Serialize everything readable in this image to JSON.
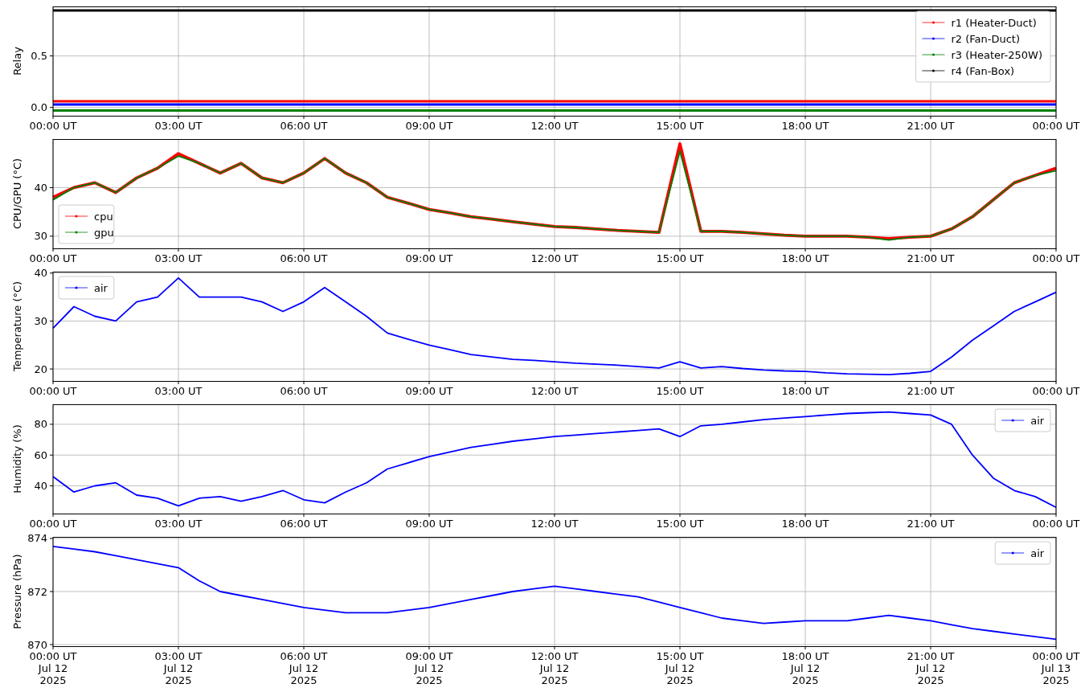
{
  "panels": [
    {
      "chart_data": {
        "type": "line",
        "grid": true,
        "legend": true,
        "ylabel": "Relay",
        "ylim": [
          -0.08,
          0.98
        ],
        "categories": [
          "00:00 UT",
          "03:00 UT",
          "06:00 UT",
          "09:00 UT",
          "12:00 UT",
          "15:00 UT",
          "18:00 UT",
          "21:00 UT",
          "00:00 UT"
        ],
        "yticks": [
          {
            "value": 0,
            "label": "0.0"
          },
          {
            "value": 0.5,
            "label": "0.5"
          }
        ],
        "series": [
          {
            "name": "r1 (Heater-Duct)",
            "color": "#ff0000",
            "values": [
              0.06,
              0.06,
              0.06,
              0.06,
              0.06,
              0.06,
              0.06,
              0.06,
              0.06
            ]
          },
          {
            "name": "r2 (Fan-Duct)",
            "color": "#0000ff",
            "values": [
              0.03,
              0.03,
              0.03,
              0.03,
              0.03,
              0.03,
              0.03,
              0.03,
              0.03
            ]
          },
          {
            "name": "r3 (Heater-250W)",
            "color": "#008000",
            "values": [
              -0.03,
              -0.03,
              -0.03,
              -0.03,
              -0.03,
              -0.03,
              -0.03,
              -0.03,
              -0.03
            ]
          },
          {
            "name": "r4 (Fan-Box)",
            "color": "#000000",
            "values": [
              0.94,
              0.94,
              0.94,
              0.94,
              0.94,
              0.94,
              0.94,
              0.94,
              0.94
            ]
          }
        ]
      }
    },
    {
      "chart_data": {
        "type": "line",
        "grid": true,
        "legend": true,
        "ylabel": "CPU/GPU (°C)",
        "ylim": [
          27.5,
          50
        ],
        "categories": [
          "00:00 UT",
          null,
          null,
          null,
          null,
          null,
          "03:00 UT",
          null,
          null,
          null,
          null,
          null,
          "06:00 UT",
          null,
          null,
          null,
          null,
          null,
          "09:00 UT",
          null,
          null,
          null,
          null,
          null,
          "12:00 UT",
          null,
          null,
          null,
          null,
          null,
          "15:00 UT",
          null,
          null,
          null,
          null,
          null,
          "18:00 UT",
          null,
          null,
          null,
          null,
          null,
          "21:00 UT",
          null,
          null,
          null,
          null,
          null,
          "00:00 UT"
        ],
        "yticks": [
          {
            "value": 30,
            "label": "30"
          },
          {
            "value": 40,
            "label": "40"
          }
        ],
        "series": [
          {
            "name": "cpu",
            "color": "#ff0000",
            "values": [
              38,
              40,
              41,
              39,
              42,
              44,
              47,
              45,
              43,
              45,
              42,
              41,
              43,
              46,
              43,
              41,
              38,
              36.8,
              35.5,
              34.8,
              34,
              33.5,
              33,
              32.5,
              32,
              31.8,
              31.5,
              31.2,
              31,
              30.8,
              49,
              31,
              31,
              30.8,
              30.5,
              30.2,
              30,
              30,
              30,
              29.8,
              29.5,
              29.8,
              30,
              31.5,
              34,
              37.5,
              41,
              42.5,
              44
            ]
          },
          {
            "name": "gpu",
            "color": "#008000",
            "values": [
              37.5,
              40,
              41,
              39,
              42,
              44,
              46.5,
              45,
              43,
              45,
              42,
              41,
              43,
              46,
              43,
              41,
              38,
              36.8,
              35.5,
              34.8,
              34,
              33.5,
              33,
              32.5,
              32,
              31.8,
              31.5,
              31.2,
              31,
              30.8,
              47.5,
              31,
              31,
              30.8,
              30.5,
              30.2,
              30,
              30,
              30,
              29.8,
              29.2,
              29.8,
              30,
              31.5,
              34,
              37.5,
              41,
              42.5,
              43.5
            ]
          }
        ]
      }
    },
    {
      "chart_data": {
        "type": "line",
        "grid": true,
        "legend": true,
        "ylabel": "Temperature (°C)",
        "ylim": [
          17.5,
          40.3
        ],
        "categories": [
          "00:00 UT",
          null,
          null,
          null,
          null,
          null,
          "03:00 UT",
          null,
          null,
          null,
          null,
          null,
          "06:00 UT",
          null,
          null,
          null,
          null,
          null,
          "09:00 UT",
          null,
          null,
          null,
          null,
          null,
          "12:00 UT",
          null,
          null,
          null,
          null,
          null,
          "15:00 UT",
          null,
          null,
          null,
          null,
          null,
          "18:00 UT",
          null,
          null,
          null,
          null,
          null,
          "21:00 UT",
          null,
          null,
          null,
          null,
          null,
          "00:00 UT"
        ],
        "yticks": [
          {
            "value": 20,
            "label": "20"
          },
          {
            "value": 30,
            "label": "30"
          },
          {
            "value": 40,
            "label": "40"
          }
        ],
        "series": [
          {
            "name": "air",
            "color": "#0000ff",
            "values": [
              28.5,
              33,
              31,
              30,
              34,
              35,
              39,
              35,
              35,
              35,
              34,
              32,
              34,
              37,
              34,
              31,
              27.5,
              26.2,
              25,
              24,
              23,
              22.5,
              22,
              21.8,
              21.5,
              21.2,
              21,
              20.8,
              20.5,
              20.2,
              21.5,
              20.2,
              20.5,
              20.1,
              19.8,
              19.6,
              19.5,
              19.2,
              19,
              18.9,
              18.8,
              19.1,
              19.5,
              22.5,
              26,
              29,
              32,
              34,
              36
            ]
          }
        ]
      }
    },
    {
      "chart_data": {
        "type": "line",
        "grid": true,
        "legend": true,
        "ylabel": "Humidity (%)",
        "ylim": [
          22,
          93
        ],
        "categories": [
          "00:00 UT",
          null,
          null,
          null,
          null,
          null,
          "03:00 UT",
          null,
          null,
          null,
          null,
          null,
          "06:00 UT",
          null,
          null,
          null,
          null,
          null,
          "09:00 UT",
          null,
          null,
          null,
          null,
          null,
          "12:00 UT",
          null,
          null,
          null,
          null,
          null,
          "15:00 UT",
          null,
          null,
          null,
          null,
          null,
          "18:00 UT",
          null,
          null,
          null,
          null,
          null,
          "21:00 UT",
          null,
          null,
          null,
          null,
          null,
          "00:00 UT"
        ],
        "yticks": [
          {
            "value": 40,
            "label": "40"
          },
          {
            "value": 60,
            "label": "60"
          },
          {
            "value": 80,
            "label": "80"
          }
        ],
        "series": [
          {
            "name": "air",
            "color": "#0000ff",
            "values": [
              46,
              36,
              40,
              42,
              34,
              32,
              27,
              32,
              33,
              30,
              33,
              37,
              31,
              29,
              36,
              42,
              51,
              55,
              59,
              62,
              65,
              67,
              69,
              70.5,
              72,
              73,
              74,
              75,
              76,
              77,
              72,
              79,
              80,
              81.5,
              83,
              84,
              85,
              86,
              87,
              87.5,
              88,
              87,
              86,
              80,
              60,
              45,
              37,
              33,
              26
            ]
          }
        ]
      }
    },
    {
      "chart_data": {
        "type": "line",
        "grid": true,
        "legend": true,
        "ylabel": "Pressure (hPa)",
        "ylim": [
          869.94,
          874.06
        ],
        "categories": [
          "00:00 UT\nJul 12\n2025",
          null,
          null,
          null,
          null,
          null,
          "03:00 UT\nJul 12\n2025",
          null,
          null,
          null,
          null,
          null,
          "06:00 UT\nJul 12\n2025",
          null,
          null,
          null,
          null,
          null,
          "09:00 UT\nJul 12\n2025",
          null,
          null,
          null,
          null,
          null,
          "12:00 UT\nJul 12\n2025",
          null,
          null,
          null,
          null,
          null,
          "15:00 UT\nJul 12\n2025",
          null,
          null,
          null,
          null,
          null,
          "18:00 UT\nJul 12\n2025",
          null,
          null,
          null,
          null,
          null,
          "21:00 UT\nJul 12\n2025",
          null,
          null,
          null,
          null,
          null,
          "00:00 UT\nJul 13\n2025"
        ],
        "yticks": [
          {
            "value": 870,
            "label": "870"
          },
          {
            "value": 872,
            "label": "872"
          },
          {
            "value": 874,
            "label": "874"
          }
        ],
        "series": [
          {
            "name": "air",
            "color": "#0000ff",
            "values": [
              873.7,
              873.6,
              873.5,
              873.35,
              873.2,
              873.05,
              872.9,
              872.4,
              872,
              871.85,
              871.7,
              871.55,
              871.4,
              871.3,
              871.2,
              871.2,
              871.2,
              871.3,
              871.4,
              871.55,
              871.7,
              871.85,
              872,
              872.1,
              872.2,
              872.1,
              872,
              871.9,
              871.8,
              871.6,
              871.4,
              871.2,
              871,
              870.9,
              870.8,
              870.85,
              870.9,
              870.9,
              870.9,
              871,
              871.1,
              871,
              870.9,
              870.75,
              870.6,
              870.5,
              870.4,
              870.3,
              870.2
            ]
          }
        ]
      }
    }
  ]
}
